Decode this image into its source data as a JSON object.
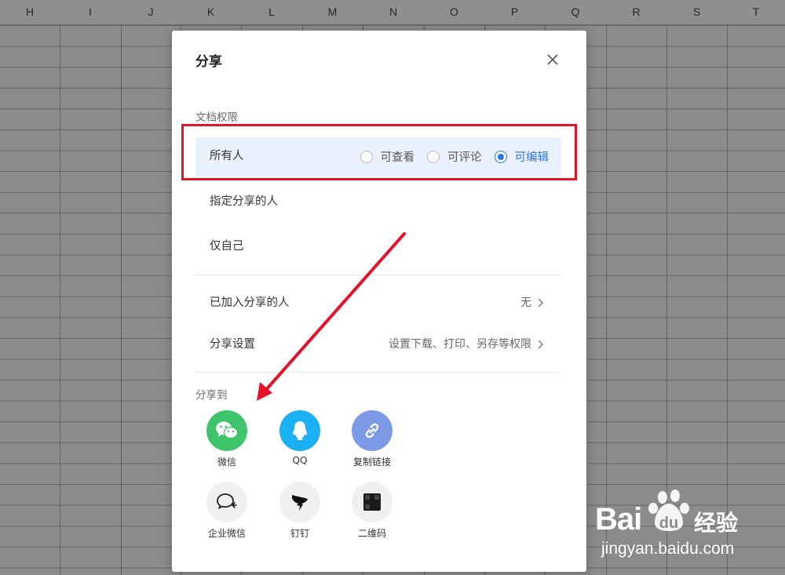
{
  "sheet": {
    "columns": [
      "H",
      "I",
      "J",
      "K",
      "L",
      "M",
      "N",
      "O",
      "P",
      "Q",
      "R",
      "S",
      "T"
    ]
  },
  "dialog": {
    "title": "分享",
    "permissions": {
      "label": "文档权限",
      "rows": [
        {
          "label": "所有人",
          "options": [
            "可查看",
            "可评论",
            "可编辑"
          ],
          "selected": "可编辑"
        },
        {
          "label": "指定分享的人"
        },
        {
          "label": "仅自己"
        }
      ]
    },
    "joined": {
      "label": "已加入分享的人",
      "value": "无"
    },
    "settings": {
      "label": "分享设置",
      "value": "设置下载、打印、另存等权限"
    },
    "share_to": {
      "label": "分享到",
      "items": [
        {
          "label": "微信",
          "icon": "wechat-icon",
          "color": "#3fc46b"
        },
        {
          "label": "QQ",
          "icon": "qq-icon",
          "color": "#1ab0f3"
        },
        {
          "label": "复制链接",
          "icon": "link-icon",
          "color": "#7d9ae6"
        },
        {
          "label": "企业微信",
          "icon": "wecom-icon",
          "color": "#f0f0f0"
        },
        {
          "label": "钉钉",
          "icon": "dingtalk-icon",
          "color": "#f0f0f0"
        },
        {
          "label": "二维码",
          "icon": "qrcode-icon",
          "color": "#f0f0f0"
        }
      ]
    }
  },
  "colors": {
    "accent": "#2f74e8",
    "highlight": "#e4132b",
    "watermark": "#ffffff"
  },
  "watermark": {
    "brand": "Bai",
    "brand_suffix": "经验",
    "url": "jingyan.baidu.com"
  }
}
